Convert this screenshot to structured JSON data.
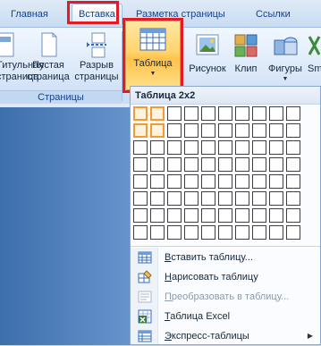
{
  "tabs": [
    {
      "label": "Главная"
    },
    {
      "label": "Вставка"
    },
    {
      "label": "Разметка страницы"
    },
    {
      "label": "Ссылки"
    }
  ],
  "ribbon": {
    "cover": {
      "line1": "Титульная",
      "line2": "страница"
    },
    "blank": {
      "line1": "Пустая",
      "line2": "страница"
    },
    "break": {
      "line1": "Разрыв",
      "line2": "страницы"
    },
    "pages_group": "Страницы",
    "table": {
      "label": "Таблица"
    },
    "picture": {
      "label": "Рисунок"
    },
    "clip": {
      "label": "Клип"
    },
    "shapes": {
      "label": "Фигуры"
    },
    "smartart": {
      "label": "Sm"
    }
  },
  "table_panel": {
    "title": "Таблица 2x2",
    "grid": {
      "cols": 10,
      "rows": 8,
      "selected_cols": 2,
      "selected_rows": 2
    },
    "menu": [
      {
        "label": "Вставить таблицу...",
        "mnemonic": "В",
        "rest": "ставить таблицу...",
        "disabled": false,
        "icon": "insert-table-icon"
      },
      {
        "label": "Нарисовать таблицу",
        "mnemonic": "Н",
        "rest": "арисовать таблицу",
        "disabled": false,
        "icon": "draw-table-icon"
      },
      {
        "label": "Преобразовать в таблицу...",
        "mnemonic": "П",
        "rest": "реобразовать в таблицу...",
        "disabled": true,
        "icon": "convert-to-table-icon"
      },
      {
        "label": "Таблица Excel",
        "mnemonic": "Т",
        "rest": "аблица Excel",
        "disabled": false,
        "icon": "excel-table-icon"
      },
      {
        "label": "Экспресс-таблицы",
        "mnemonic": "Э",
        "rest": "кспресс-таблицы",
        "disabled": false,
        "icon": "quick-tables-icon",
        "submenu": true
      }
    ]
  },
  "colors": {
    "highlight": "#e31b23",
    "selection": "#f39a34",
    "ribbon_text": "#15428b"
  }
}
